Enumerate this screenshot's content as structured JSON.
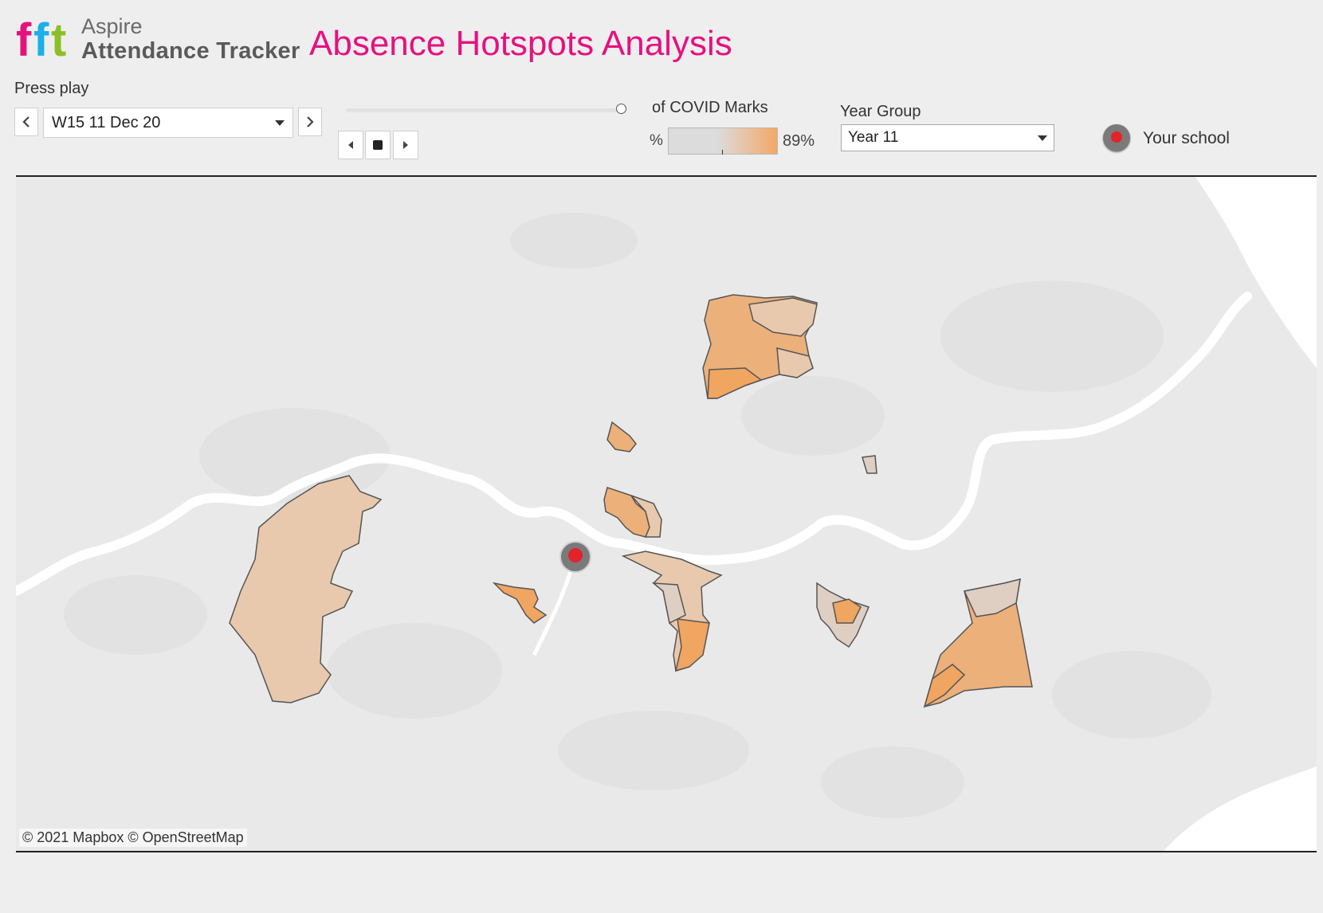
{
  "header": {
    "brand_line1": "Aspire",
    "brand_line2": "Attendance Tracker",
    "title": "Absence Hotspots Analysis",
    "title_color": "#e5127d",
    "logo_letters": [
      "f",
      "f",
      "t"
    ],
    "logo_colors": [
      "#e5127d",
      "#1ab0e8",
      "#8cbf26"
    ]
  },
  "playback": {
    "label": "Press play",
    "week_value": "W15 11 Dec 20",
    "prev_icon": "chevron-left-icon",
    "next_icon": "chevron-right-icon",
    "controls": [
      "step-back-icon",
      "stop-icon",
      "step-forward-icon"
    ],
    "slider_position": 0.95
  },
  "legend": {
    "title": "of COVID Marks",
    "min_label": "%",
    "max_label": "89%",
    "color_low": "#dcdcdc",
    "color_high": "#f3a866"
  },
  "filters": {
    "year_group_label": "Year Group",
    "year_group_value": "Year 11"
  },
  "school_legend": {
    "label": "Your school",
    "marker_color": "#e3222b"
  },
  "map": {
    "attribution": "© 2021 Mapbox  © OpenStreetMap",
    "background_color": "#e9e9ea",
    "river_color": "#ffffff",
    "region_colors": [
      "#e8c9ad",
      "#ecb07a",
      "#f0a561",
      "#dfcfc2"
    ]
  }
}
